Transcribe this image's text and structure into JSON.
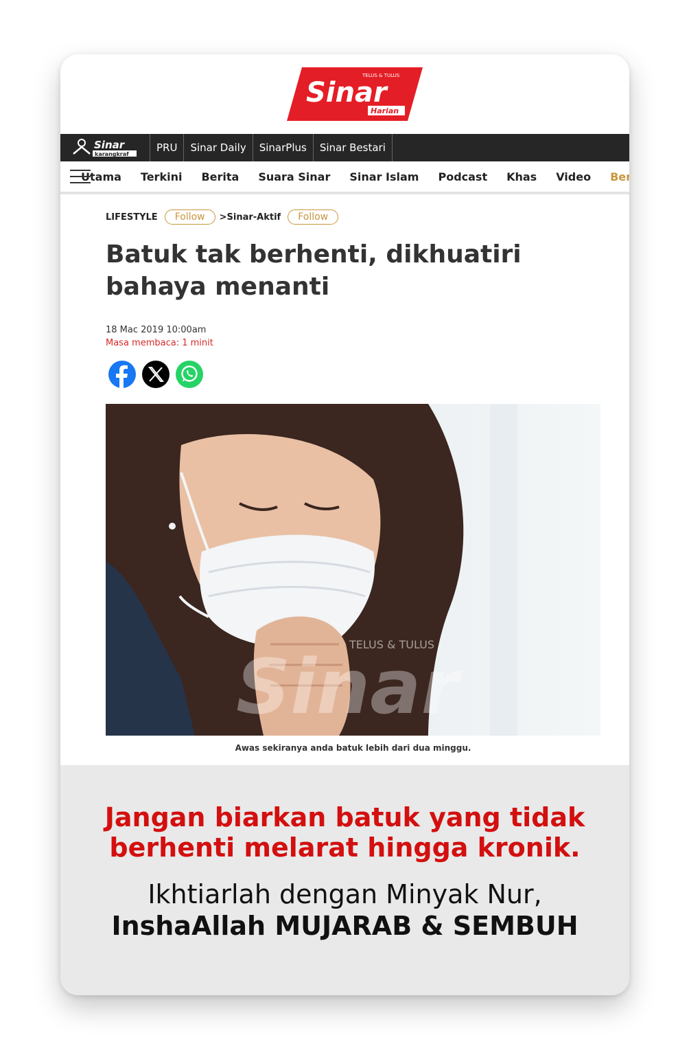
{
  "logo": {
    "tagline": "TELUS & TULUS",
    "name": "Sinar",
    "sub": "Harian"
  },
  "topbar": {
    "brand": "Sinar karangkraf",
    "items": [
      "PRU",
      "Sinar Daily",
      "SinarPlus",
      "Sinar Bestari"
    ]
  },
  "nav": {
    "items": [
      "Utama",
      "Terkini",
      "Berita",
      "Suara Sinar",
      "Sinar Islam",
      "Podcast",
      "Khas",
      "Video"
    ],
    "more": "Ber"
  },
  "article": {
    "category": "LIFESTYLE",
    "follow_label": "Follow",
    "subcategory": ">Sinar-Aktif",
    "headline": "Batuk tak berhenti, dikhuatiri bahaya menanti",
    "date": "18 Mac 2019 10:00am",
    "read_time": "Masa membaca: 1 minit",
    "share_icons": [
      "facebook-icon",
      "x-icon",
      "whatsapp-icon"
    ],
    "watermark": "TELUS & TULUS",
    "caption": "Awas sekiranya anda batuk lebih dari dua minggu."
  },
  "footer": {
    "headline": "Jangan biarkan batuk yang tidak berhenti melarat hingga kronik.",
    "line1": "Ikhtiarlah dengan Minyak Nur,",
    "line2": "InshaAllah MUJARAB & SEMBUH"
  },
  "colors": {
    "brand_red": "#e41e26",
    "accent_gold": "#c8963e",
    "footer_red": "#d30f0f"
  }
}
